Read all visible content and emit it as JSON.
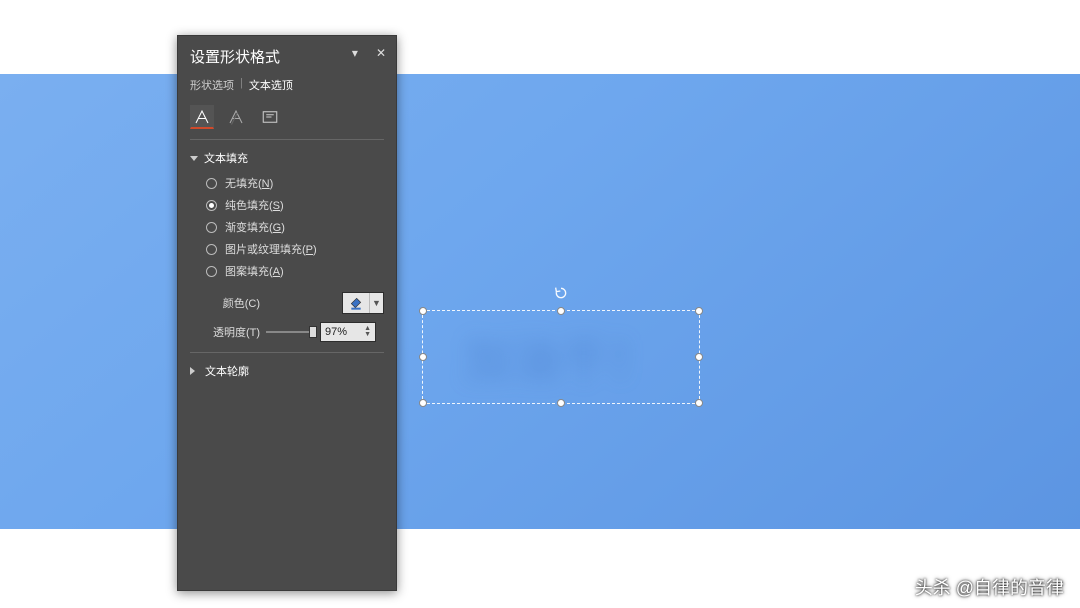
{
  "panel": {
    "title": "设置形状格式",
    "tabs": {
      "shape": "形状选项",
      "text": "文本选顶"
    },
    "iconrow": {
      "fillOutline": "text-fill-icon",
      "effects": "text-effects-icon",
      "textbox": "textbox-icon"
    },
    "sections": {
      "textFill": {
        "title": "文本填充",
        "options": {
          "none": {
            "label": "无填充",
            "hotkey": "N"
          },
          "solid": {
            "label": "纯色填充",
            "hotkey": "S"
          },
          "gradient": {
            "label": "渐变填充",
            "hotkey": "G"
          },
          "picture": {
            "label": "图片或纹理填充",
            "hotkey": "P"
          },
          "pattern": {
            "label": "图案填充",
            "hotkey": "A"
          }
        },
        "colorLabel": "颜色(C)",
        "transparencyLabel": "透明度(T)",
        "transparencyValue": "97%",
        "transparencyPercent": 97
      },
      "textOutline": {
        "title": "文本轮廓"
      }
    }
  },
  "canvas": {
    "blurredText": "加油干！"
  },
  "watermark": "头杀 @自律的音律"
}
